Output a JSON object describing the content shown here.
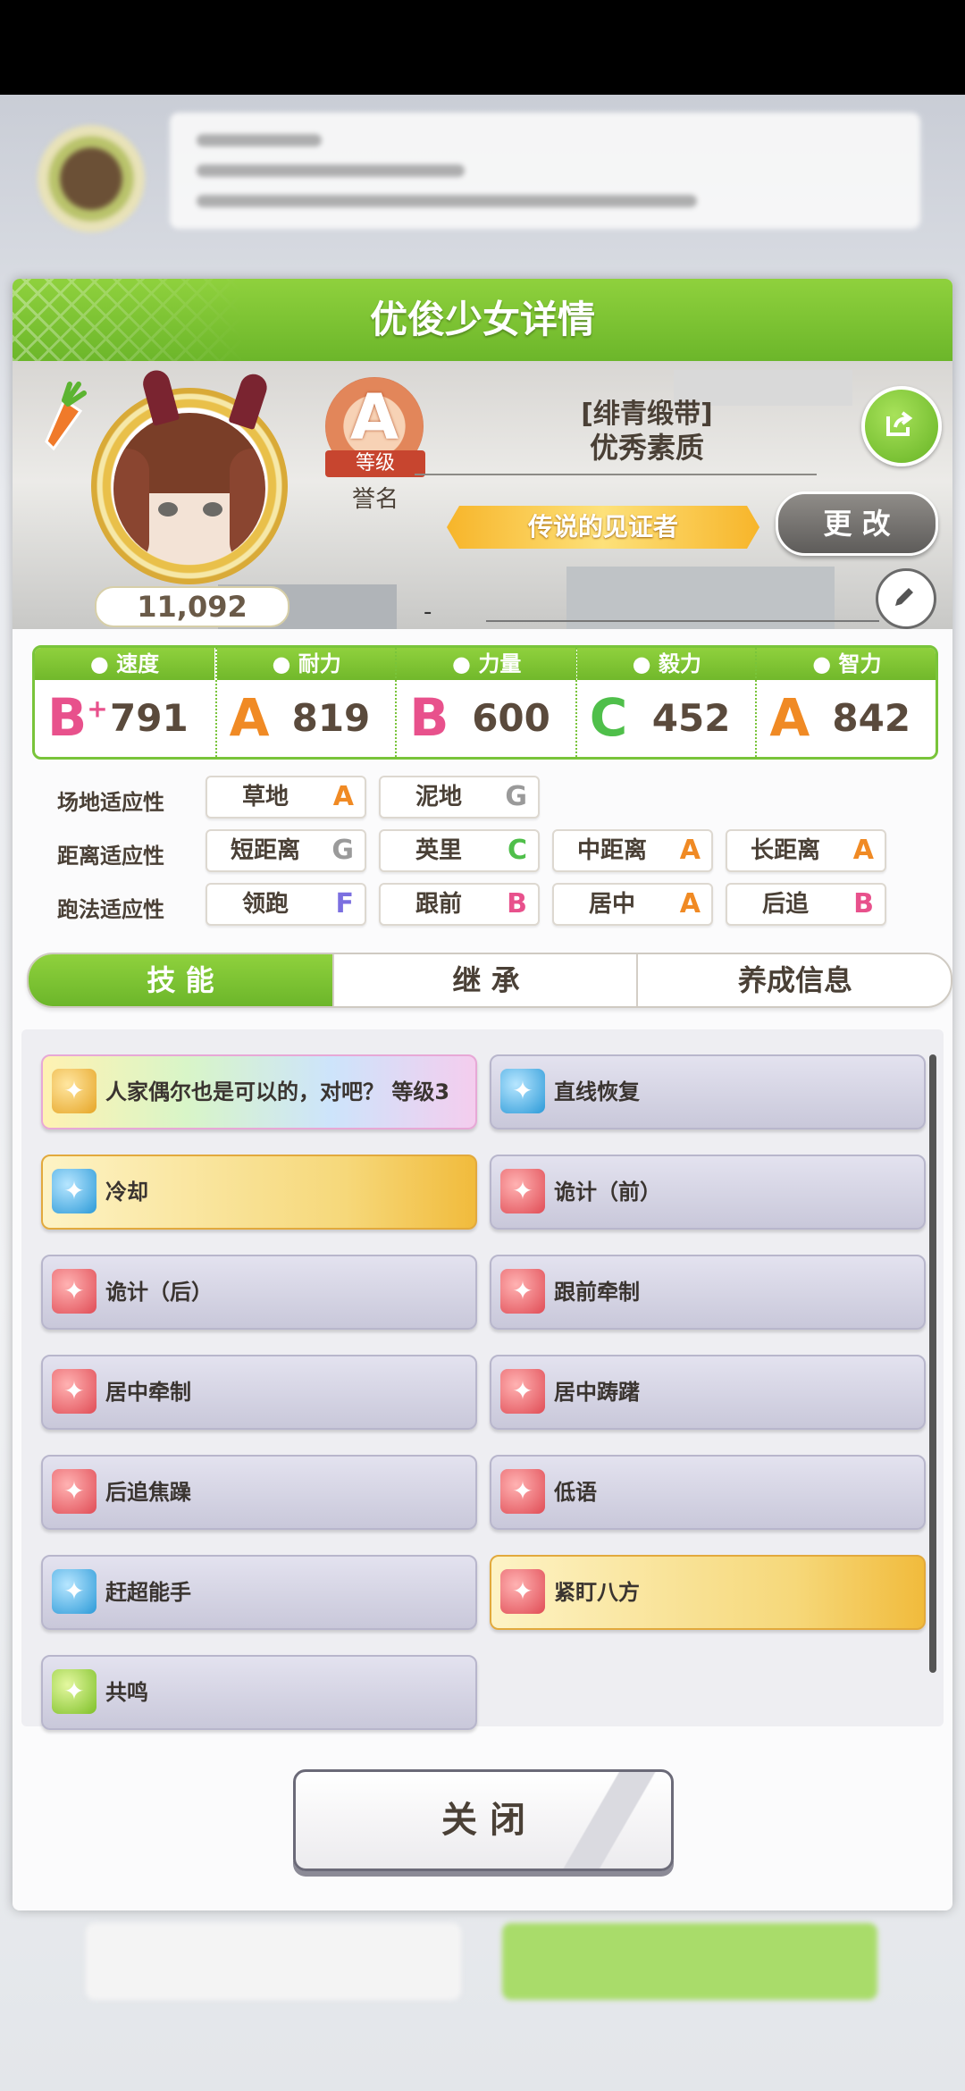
{
  "panel": {
    "title": "优俊少女详情"
  },
  "profile": {
    "fans": "11,092",
    "rank_letter": "A",
    "rank_ribbon": "等级",
    "rank_sub": "誉名",
    "title_bracket": "[绯青缎带]",
    "title_name": "优秀素质",
    "legend_title": "传说的见证者",
    "change_label": "更 改",
    "dash": "-"
  },
  "stats": [
    {
      "name": "速度",
      "grade": "B",
      "grade_plus": "+",
      "value": "791",
      "color": "#e8518c",
      "icon": "shoe-icon"
    },
    {
      "name": "耐力",
      "grade": "A",
      "value": "819",
      "color": "#f08a24",
      "icon": "heart-icon"
    },
    {
      "name": "力量",
      "grade": "B",
      "value": "600",
      "color": "#e8518c",
      "icon": "muscle-icon"
    },
    {
      "name": "毅力",
      "grade": "C",
      "value": "452",
      "color": "#4fbf4a",
      "icon": "flame-icon"
    },
    {
      "name": "智力",
      "grade": "A",
      "value": "842",
      "color": "#f08a24",
      "icon": "graduation-cap-icon"
    }
  ],
  "aptitude": {
    "surface": {
      "label": "场地适应性",
      "items": [
        {
          "name": "草地",
          "grade": "A"
        },
        {
          "name": "泥地",
          "grade": "G"
        }
      ]
    },
    "distance": {
      "label": "距离适应性",
      "items": [
        {
          "name": "短距离",
          "grade": "G"
        },
        {
          "name": "英里",
          "grade": "C"
        },
        {
          "name": "中距离",
          "grade": "A"
        },
        {
          "name": "长距离",
          "grade": "A"
        }
      ]
    },
    "style": {
      "label": "跑法适应性",
      "items": [
        {
          "name": "领跑",
          "grade": "F"
        },
        {
          "name": "跟前",
          "grade": "B"
        },
        {
          "name": "居中",
          "grade": "A"
        },
        {
          "name": "后追",
          "grade": "B"
        }
      ]
    }
  },
  "grade_colors": {
    "A": "#f08a24",
    "B": "#e8518c",
    "C": "#4fbf4a",
    "F": "#7b6fe0",
    "G": "#9a9a9a"
  },
  "tabs": [
    "技 能",
    "继 承",
    "养成信息"
  ],
  "skills": [
    {
      "label": "人家偶尔也是可以的，对吧？ 等级3",
      "icon": "gold",
      "style": "rainbow"
    },
    {
      "label": "直线恢复",
      "icon": "blue",
      "style": "normal"
    },
    {
      "label": "冷却",
      "icon": "blue",
      "style": "gold"
    },
    {
      "label": "诡计（前）",
      "icon": "red",
      "style": "normal"
    },
    {
      "label": "诡计（后）",
      "icon": "red",
      "style": "normal"
    },
    {
      "label": "跟前牵制",
      "icon": "red",
      "style": "normal"
    },
    {
      "label": "居中牵制",
      "icon": "red",
      "style": "normal"
    },
    {
      "label": "居中踌躇",
      "icon": "red",
      "style": "normal"
    },
    {
      "label": "后追焦躁",
      "icon": "red",
      "style": "normal"
    },
    {
      "label": "低语",
      "icon": "red",
      "style": "normal"
    },
    {
      "label": "赶超能手",
      "icon": "blue",
      "style": "normal"
    },
    {
      "label": "紧盯八方",
      "icon": "red",
      "style": "gold"
    },
    {
      "label": "共鸣",
      "icon": "green",
      "style": "normal"
    }
  ],
  "close_label": "关 闭"
}
